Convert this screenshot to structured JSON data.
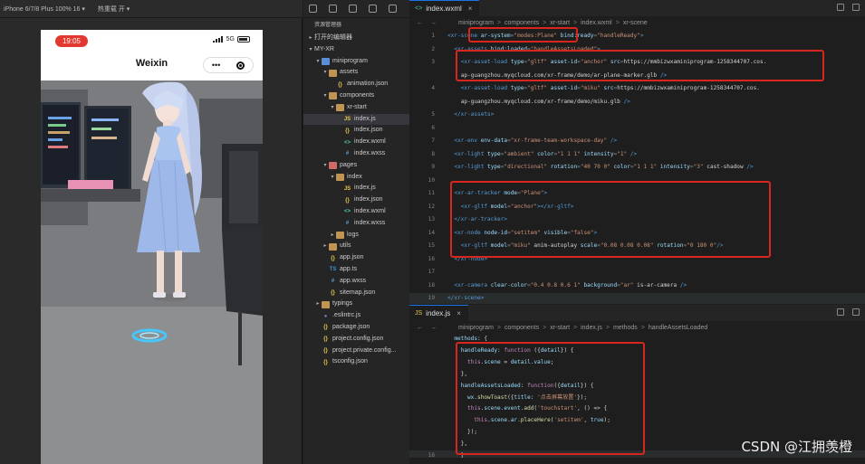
{
  "simulator": {
    "device_label": "iPhone 6/7/8 Plus 100% 16 ▾",
    "network_label": "热重载 开 ▾",
    "time": "19:05",
    "network": "5G",
    "nav_title": "Weixin",
    "capsule_more": "•••"
  },
  "explorer": {
    "header": "资源管理器",
    "open_editors": "打开的编辑器",
    "project": "MY-XR",
    "tree": [
      {
        "label": "miniprogram",
        "depth": 1,
        "type": "folder-blue",
        "open": true
      },
      {
        "label": "assets",
        "depth": 2,
        "type": "folder",
        "open": true
      },
      {
        "label": "animation.json",
        "depth": 3,
        "type": "json"
      },
      {
        "label": "components",
        "depth": 2,
        "type": "folder",
        "open": true
      },
      {
        "label": "xr-start",
        "depth": 3,
        "type": "folder",
        "open": true
      },
      {
        "label": "index.js",
        "depth": 4,
        "type": "js",
        "selected": true
      },
      {
        "label": "index.json",
        "depth": 4,
        "type": "json"
      },
      {
        "label": "index.wxml",
        "depth": 4,
        "type": "wxml"
      },
      {
        "label": "index.wxss",
        "depth": 4,
        "type": "wxss"
      },
      {
        "label": "pages",
        "depth": 2,
        "type": "folder-red",
        "open": true
      },
      {
        "label": "index",
        "depth": 3,
        "type": "folder",
        "open": true
      },
      {
        "label": "index.js",
        "depth": 4,
        "type": "js"
      },
      {
        "label": "index.json",
        "depth": 4,
        "type": "json"
      },
      {
        "label": "index.wxml",
        "depth": 4,
        "type": "wxml"
      },
      {
        "label": "index.wxss",
        "depth": 4,
        "type": "wxss"
      },
      {
        "label": "logs",
        "depth": 3,
        "type": "folder",
        "open": false
      },
      {
        "label": "utils",
        "depth": 2,
        "type": "folder",
        "open": false
      },
      {
        "label": "app.json",
        "depth": 2,
        "type": "json"
      },
      {
        "label": "app.ts",
        "depth": 2,
        "type": "ts"
      },
      {
        "label": "app.wxss",
        "depth": 2,
        "type": "wxss"
      },
      {
        "label": "sitemap.json",
        "depth": 2,
        "type": "json"
      },
      {
        "label": "typings",
        "depth": 1,
        "type": "folder",
        "open": false
      },
      {
        "label": ".eslintrc.js",
        "depth": 1,
        "type": "rc"
      },
      {
        "label": "package.json",
        "depth": 1,
        "type": "json"
      },
      {
        "label": "project.config.json",
        "depth": 1,
        "type": "json"
      },
      {
        "label": "project.private.config...",
        "depth": 1,
        "type": "json"
      },
      {
        "label": "tsconfig.json",
        "depth": 1,
        "type": "json"
      }
    ]
  },
  "editor_top": {
    "tab": "index.wxml",
    "breadcrumb": [
      "miniprogram",
      "components",
      "xr-start",
      "index.wxml",
      "xr-scene"
    ],
    "lines": [
      {
        "n": "1",
        "text": "<xr-scene ar-system=\"modes:Plane\" bind:ready=\"handleReady\">"
      },
      {
        "n": "2",
        "text": "  <xr-assets bind:loaded=\"handleAssetsLoaded\">"
      },
      {
        "n": "3",
        "text": "    <xr-asset-load type=\"gltf\" asset-id=\"anchor\" src=\"https://mmbizwxaminiprogram-1258344707.cos."
      },
      {
        "n": "",
        "text": "    ap-guangzhou.myqcloud.com/xr-frame/demo/ar-plane-marker.glb\" />"
      },
      {
        "n": "4",
        "text": "    <xr-asset-load type=\"gltf\" asset-id=\"miku\" src=\"https://mmbizwxaminiprogram-1258344707.cos."
      },
      {
        "n": "",
        "text": "    ap-guangzhou.myqcloud.com/xr-frame/demo/miku.glb\" />"
      },
      {
        "n": "5",
        "text": "  </xr-assets>"
      },
      {
        "n": "6",
        "text": ""
      },
      {
        "n": "7",
        "text": "  <xr-env env-data=\"xr-frame-team-workspace-day\" />"
      },
      {
        "n": "8",
        "text": "  <xr-light type=\"ambient\" color=\"1 1 1\" intensity=\"1\" />"
      },
      {
        "n": "9",
        "text": "  <xr-light type=\"directional\" rotation=\"40 70 0\" color=\"1 1 1\" intensity=\"3\" cast-shadow />"
      },
      {
        "n": "10",
        "text": ""
      },
      {
        "n": "11",
        "text": "  <xr-ar-tracker mode=\"Plane\">"
      },
      {
        "n": "12",
        "text": "    <xr-gltf model=\"anchor\"></xr-gltf>"
      },
      {
        "n": "13",
        "text": "  </xr-ar-tracker>"
      },
      {
        "n": "14",
        "text": "  <xr-node node-id=\"setitem\" visible=\"false\">"
      },
      {
        "n": "15",
        "text": "    <xr-gltf model=\"miku\" anim-autoplay scale=\"0.08 0.08 0.08\" rotation=\"0 180 0\"/>"
      },
      {
        "n": "16",
        "text": "  </xr-node>"
      },
      {
        "n": "17",
        "text": ""
      },
      {
        "n": "18",
        "text": "  <xr-camera clear-color=\"0.4 0.8 0.6 1\" background=\"ar\" is-ar-camera />"
      },
      {
        "n": "19",
        "text": "</xr-scene>"
      }
    ]
  },
  "editor_bottom": {
    "tab": "index.js",
    "breadcrumb": [
      "miniprogram",
      "components",
      "xr-start",
      "index.js",
      "methods",
      "handleAssetsLoaded"
    ],
    "lines": [
      {
        "n": "",
        "text": "  methods: {"
      },
      {
        "n": "",
        "text": "    handleReady: function ({detail}) {"
      },
      {
        "n": "",
        "text": "      this.scene = detail.value;"
      },
      {
        "n": "",
        "text": "    },"
      },
      {
        "n": "",
        "text": "    handleAssetsLoaded: function({detail}) {"
      },
      {
        "n": "",
        "text": "      wx.showToast({title: '点击屏幕放置'});"
      },
      {
        "n": "",
        "text": "      this.scene.event.add('touchstart', () => {"
      },
      {
        "n": "",
        "text": "        this.scene.ar.placeHere('setitem', true);"
      },
      {
        "n": "",
        "text": "      });"
      },
      {
        "n": "",
        "text": "    },"
      },
      {
        "n": "16",
        "text": "    }"
      }
    ]
  },
  "watermark": "CSDN @江拥羡橙",
  "colors": {
    "highlight": "#d7261e",
    "accent_tab": "#1a73e8"
  }
}
